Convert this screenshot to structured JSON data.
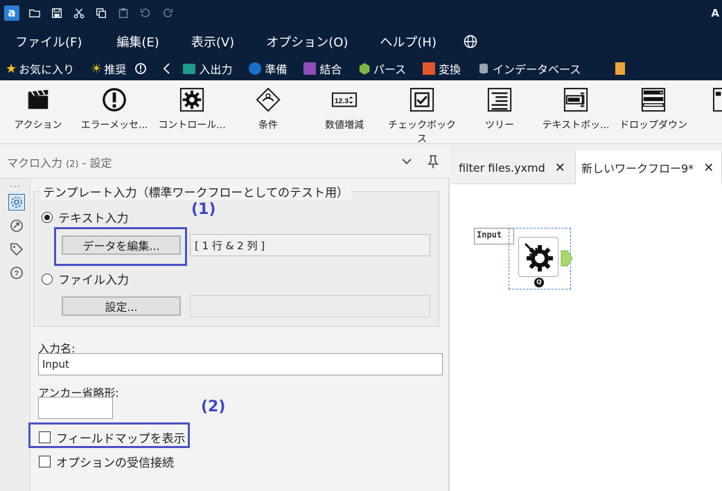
{
  "titlebar": {
    "app_title": "A"
  },
  "menu": {
    "items": [
      "ファイル(F)",
      "編集(E)",
      "表示(V)",
      "オプション(O)",
      "ヘルプ(H)"
    ]
  },
  "categories": {
    "favorites": "お気に入り",
    "recommended": "推奨",
    "inout": "入出力",
    "prep": "準備",
    "join": "結合",
    "parse": "パース",
    "transform": "変換",
    "indb": "インデータベース"
  },
  "palette": {
    "tools": [
      "アクション",
      "エラーメッセ...",
      "コントロール...",
      "条件",
      "数値増減",
      "チェックボックス",
      "ツリー",
      "テキストボッ...",
      "ドロップダウン"
    ],
    "numeric_icon_text": "12.3"
  },
  "panel": {
    "title": "マクロ入力",
    "title_count": "(2)",
    "title_suffix": "- 設定",
    "dots": "...",
    "template_group_label": "テンプレート入力（標準ワークフローとしてのテスト用）",
    "text_input_label": "テキスト入力",
    "edit_data_button": "データを編集...",
    "data_summary": "[ 1 行 & 2 列 ]",
    "file_input_label": "ファイル入力",
    "settings_button": "設定...",
    "input_name_label": "入力名:",
    "input_name_value": "Input",
    "anchor_label": "アンカー省略形:",
    "anchor_value": "",
    "show_field_map_label": "フィールドマップを表示",
    "optional_connection_label": "オプションの受信接続",
    "annotation_1": "(1)",
    "annotation_2": "(2)"
  },
  "canvas": {
    "tabs": [
      {
        "label": "filter files.yxmd",
        "close": "✕"
      },
      {
        "label": "新しいワークフロー9*",
        "close": "✕"
      }
    ],
    "node_label": "Input",
    "node_badge": "Q"
  },
  "colors": {
    "chrome_dark": "#0b1f3a",
    "highlight": "#4a53c4",
    "cat_inout": "#1f9a8a",
    "cat_prep": "#1a6fc9",
    "cat_join": "#8e4fb8",
    "cat_parse": "#7cb342",
    "cat_transform": "#e2572b",
    "node_anchor": "#a6d86a"
  }
}
